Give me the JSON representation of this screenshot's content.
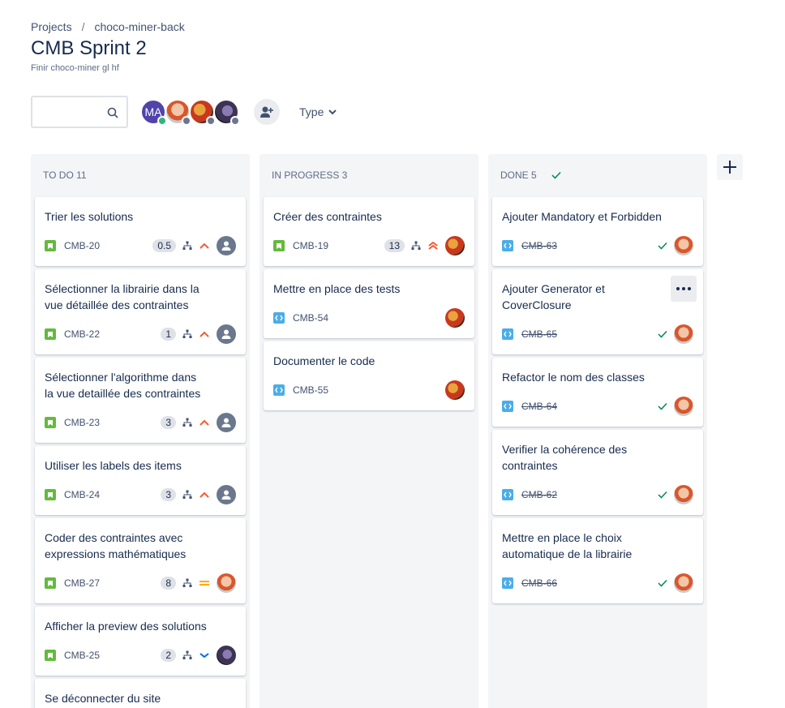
{
  "breadcrumb": {
    "projects": "Projects",
    "separator": "/",
    "project": "choco-miner-back"
  },
  "title": "CMB Sprint 2",
  "subtitle": "Finir choco-miner gl hf",
  "search": {
    "placeholder": ""
  },
  "avatars": [
    {
      "initials": "MA"
    }
  ],
  "filters": {
    "type_label": "Type"
  },
  "columns": [
    {
      "name": "TO DO 11"
    },
    {
      "name": "IN PROGRESS 3"
    },
    {
      "name": "DONE 5"
    }
  ],
  "todo": [
    {
      "summary": "Trier les solutions",
      "key": "CMB-20",
      "points": "0.5",
      "priority": "high"
    },
    {
      "summary": "Sélectionner la librairie dans la vue détaillée des contraintes",
      "key": "CMB-22",
      "points": "1",
      "priority": "high"
    },
    {
      "summary": "Sélectionner l'algorithme dans la vue detaillée des contraintes",
      "key": "CMB-23",
      "points": "3",
      "priority": "high"
    },
    {
      "summary": "Utiliser les labels des items",
      "key": "CMB-24",
      "points": "3",
      "priority": "high"
    },
    {
      "summary": "Coder des contraintes avec expressions mathématiques",
      "key": "CMB-27",
      "points": "8",
      "priority": "medium"
    },
    {
      "summary": "Afficher la preview des solutions",
      "key": "CMB-25",
      "points": "2",
      "priority": "low"
    },
    {
      "summary": "Se déconnecter du site"
    }
  ],
  "in_progress": [
    {
      "summary": "Créer des contraintes",
      "key": "CMB-19",
      "points": "13",
      "priority": "highest"
    },
    {
      "summary": "Mettre en place des tests",
      "key": "CMB-54"
    },
    {
      "summary": "Documenter le code",
      "key": "CMB-55"
    }
  ],
  "done": [
    {
      "summary": "Ajouter Mandatory et Forbidden",
      "key": "CMB-63"
    },
    {
      "summary": "Ajouter Generator et CoverClosure",
      "key": "CMB-65"
    },
    {
      "summary": "Refactor le nom des classes",
      "key": "CMB-64"
    },
    {
      "summary": "Verifier la cohérence des contraintes",
      "key": "CMB-62"
    },
    {
      "summary": "Mettre en place le choix automatique de la librairie",
      "key": "CMB-66"
    }
  ],
  "colors": {
    "story": "#63ba3c",
    "task": "#4bade8",
    "high": "#ff5630",
    "medium": "#ffab00",
    "low": "#0065ff",
    "done_check": "#00875a"
  }
}
